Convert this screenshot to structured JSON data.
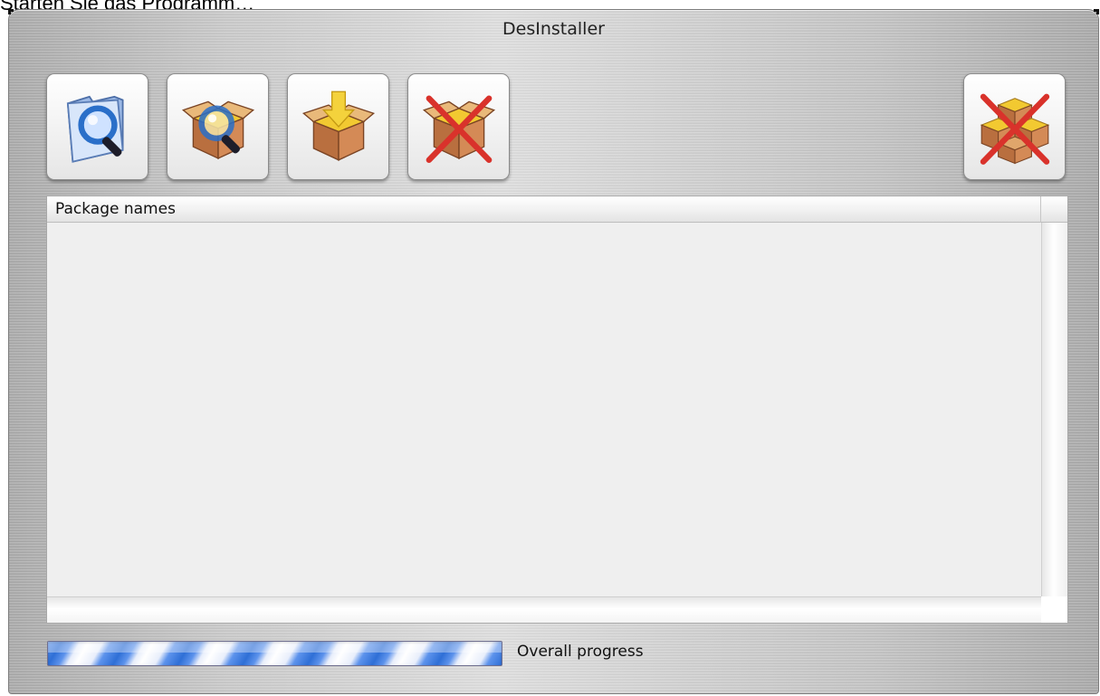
{
  "caption": "Starten Sie das Programm…",
  "window": {
    "title": "DesInstaller"
  },
  "toolbar": {
    "buttons": [
      {
        "id": "btn1",
        "icon": "folder-search-icon"
      },
      {
        "id": "btn2",
        "icon": "package-search-icon"
      },
      {
        "id": "btn3",
        "icon": "package-install-icon"
      },
      {
        "id": "btn4",
        "icon": "package-remove-icon"
      },
      {
        "id": "btn5",
        "icon": "packages-remove-all-icon"
      }
    ]
  },
  "table": {
    "columns": [
      "Package names"
    ],
    "rows": []
  },
  "progress": {
    "label": "Overall progress",
    "state": "indeterminate"
  },
  "colors": {
    "progress_blue": "#2f6fd6",
    "box_brown": "#c07a4a",
    "box_yellow": "#f2c931",
    "cross_red": "#d9322b",
    "lens_blue": "#2a6fc9"
  }
}
